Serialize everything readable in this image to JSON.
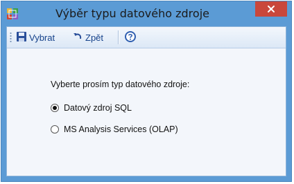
{
  "window": {
    "title": "Výběr typu datového zdroje",
    "close_label": "×"
  },
  "toolbar": {
    "select_label": "Vybrat",
    "back_label": "Zpět"
  },
  "main": {
    "prompt": "Vyberte prosím typ datového zdroje:",
    "options": [
      {
        "label": "Datový zdroj SQL",
        "selected": true
      },
      {
        "label": "MS Analysis Services (OLAP)",
        "selected": false
      }
    ]
  },
  "colors": {
    "titlebar": "#5b9bd5",
    "close": "#c9473b",
    "toolbar_text": "#15428b"
  },
  "icons": [
    "app-icon",
    "save-icon",
    "undo-icon",
    "help-icon",
    "close-icon"
  ]
}
